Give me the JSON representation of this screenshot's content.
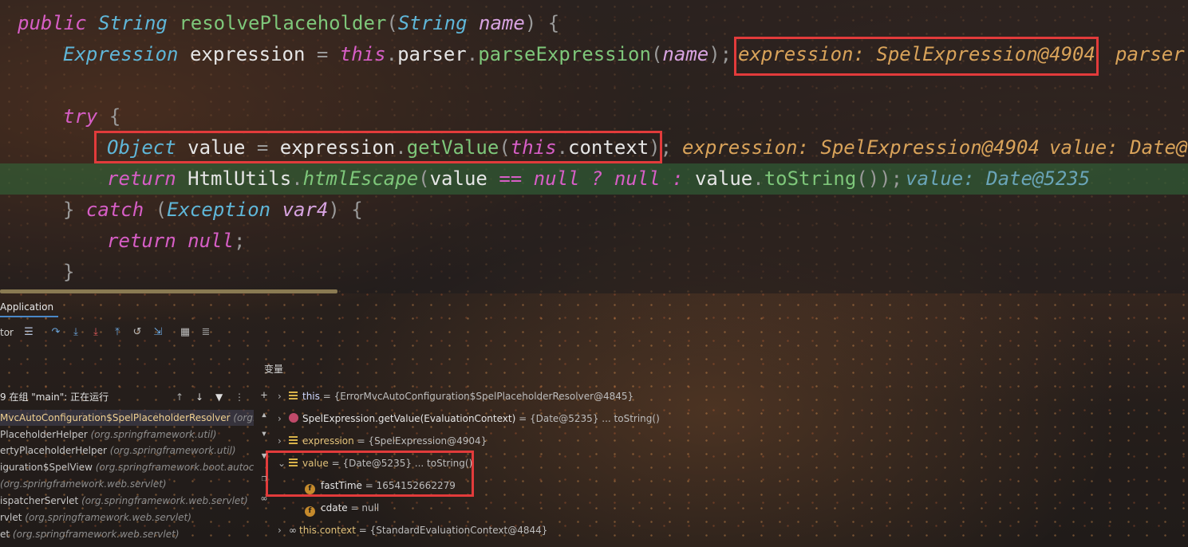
{
  "code": {
    "line1": {
      "kw_public": "public",
      "type_String": "String",
      "method": "resolvePlaceholder",
      "paren_open": "(",
      "type_String2": "String",
      "param": "name",
      "tail": ") {"
    },
    "line2": {
      "type_Expression": "Expression",
      "var": "expression",
      "eq": "=",
      "kw_this": "this",
      "dot1": ".",
      "parser": "parser",
      "dot2": ".",
      "call": "parseExpression",
      "open": "(",
      "arg": "name",
      "close": ");",
      "hint1": "expression: SpelExpression@4904",
      "hint2": "parser"
    },
    "line4": {
      "kw_try": "try",
      "brace": "{"
    },
    "line5": {
      "type_Object": "Object",
      "var": "value",
      "eq": "=",
      "obj": "expression",
      "dot": ".",
      "call": "getValue",
      "open": "(",
      "kw_this": "this",
      "dot2": ".",
      "field": "context",
      "close": ");",
      "hint1": "expression: SpelExpression@4904",
      "hint2": "value: Date@"
    },
    "line6": {
      "kw_return": "return",
      "cls": "HtmlUtils",
      "dot": ".",
      "call": "htmlEscape",
      "open": "(",
      "v1": "value",
      "eqeq": "==",
      "kw_null1": "null",
      "q": "?",
      "kw_null2": "null",
      "colon": ":",
      "v2": "value",
      "dot2": ".",
      "call2": "toString",
      "close": "());",
      "hint": "value: Date@5235"
    },
    "line7": {
      "brace": "}",
      "kw_catch": "catch",
      "open": "(",
      "type_Exception": "Exception",
      "param": "var4",
      "close": ") {"
    },
    "line8": {
      "kw_return": "return",
      "kw_null": "null",
      "semi": ";"
    },
    "line9": {
      "brace": "}"
    }
  },
  "debug": {
    "tab_label": "Application",
    "toolbar_label": "tor",
    "thread_status": "9 在组 \"main\": 正在运行",
    "frames": [
      {
        "main": "MvcAutoConfiguration$SpelPlaceholderResolver",
        "pkg": "(org.sp"
      },
      {
        "main": "PlaceholderHelper",
        "pkg": "(org.springframework.util)"
      },
      {
        "main": "ertyPlaceholderHelper",
        "pkg": "(org.springframework.util)"
      },
      {
        "main": "iguration$SpelView",
        "pkg": "(org.springframework.boot.autoco"
      },
      {
        "main": "",
        "pkg": "(org.springframework.web.servlet)"
      },
      {
        "main": "ispatcherServlet",
        "pkg": "(org.springframework.web.servlet)"
      },
      {
        "main": "rvlet",
        "pkg": "(org.springframework.web.servlet)"
      },
      {
        "main": "et",
        "pkg": "(org.springframework.web.servlet)"
      }
    ],
    "variables_title": "变量",
    "variables": [
      {
        "name": "this",
        "value": "= {ErrorMvcAutoConfiguration$SpelPlaceholderResolver@4845}"
      },
      {
        "name": "SpelExpression.getValue(EvaluationContext)",
        "value": "= {Date@5235} ... toString()"
      },
      {
        "name": "expression",
        "value": "= {SpelExpression@4904}"
      },
      {
        "name": "value",
        "value": "= {Date@5235} ... toString()"
      },
      {
        "name": "fastTime",
        "value": "= 1654152662279"
      },
      {
        "name": "cdate",
        "value": "= null"
      },
      {
        "name": "this.context",
        "value": "= {StandardEvaluationContext@4844}"
      }
    ]
  },
  "colors": {
    "highlight_box": "#e23b3b",
    "current_line": "#326e3c",
    "keyword": "#d75ec6",
    "type": "#5fb6d8",
    "method": "#7ec77a"
  }
}
